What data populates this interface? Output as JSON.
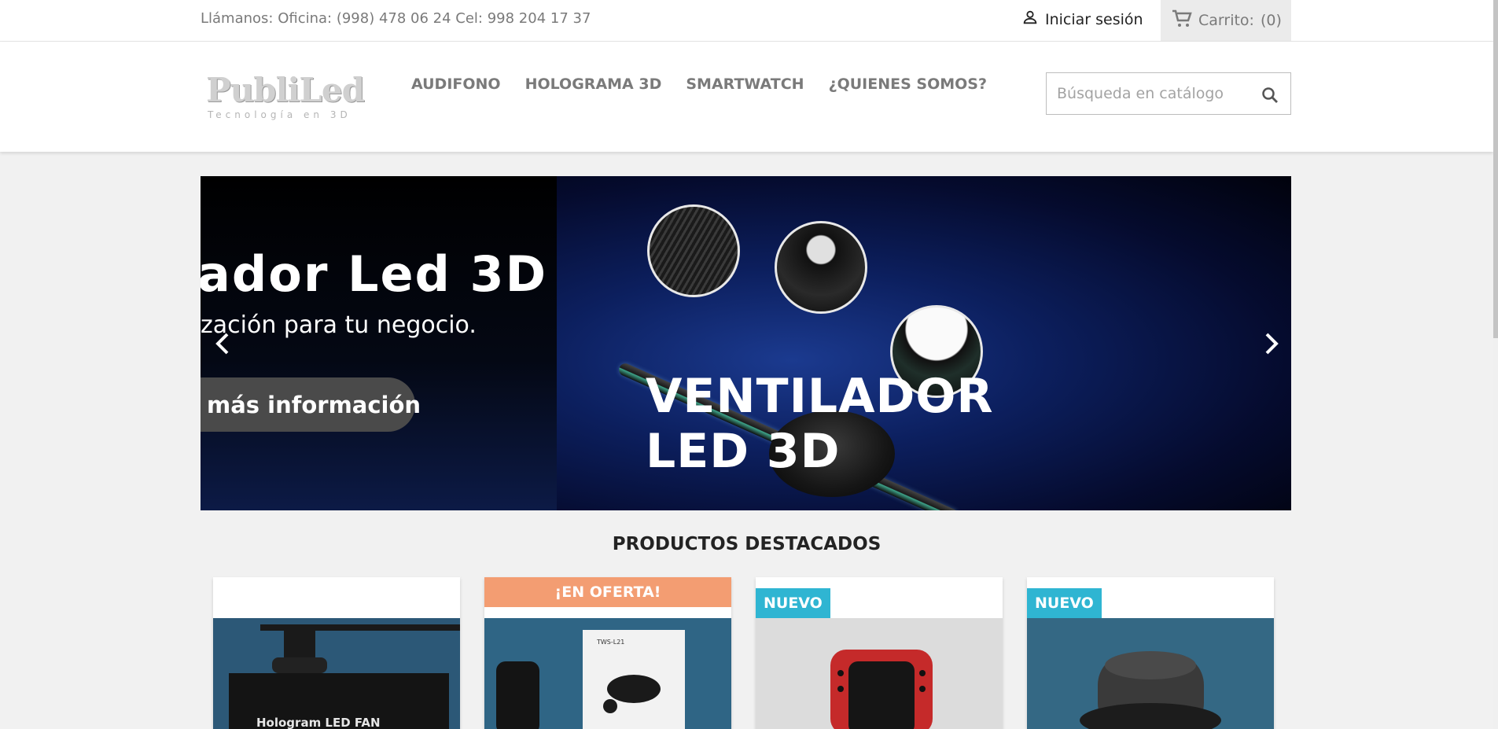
{
  "topbar": {
    "contact": "Llámanos: Oficina: (998) 478 06 24 Cel: 998 204 17 37",
    "signin_label": "Iniciar sesión",
    "cart_label": "Carrito:",
    "cart_count": "(0)"
  },
  "header": {
    "logo_main": "PubliLed",
    "logo_sub": "Tecnología en 3D",
    "nav": [
      "AUDIFONO",
      "HOLOGRAMA 3D",
      "SMARTWATCH",
      "¿QUIENES SOMOS?"
    ],
    "search_placeholder": "Búsqueda en catálogo"
  },
  "slider": {
    "left_title": "ador Led 3D",
    "left_subtitle": "zación para tu negocio.",
    "left_button": "más información",
    "title_line1": "VENTILADOR",
    "title_line2": "LED 3D"
  },
  "featured": {
    "title": "PRODUCTOS DESTACADOS",
    "products": [
      {
        "badge": "",
        "image_caption": "Hologram LED FAN"
      },
      {
        "badge": "¡EN OFERTA!",
        "image_caption": "TWS-L21"
      },
      {
        "badge": "NUEVO",
        "image_caption": ""
      },
      {
        "badge": "NUEVO",
        "image_caption": ""
      }
    ]
  },
  "colors": {
    "sale_badge": "#f39d72",
    "new_badge": "#2fb5d2",
    "nav_text": "#7a7a7a"
  }
}
